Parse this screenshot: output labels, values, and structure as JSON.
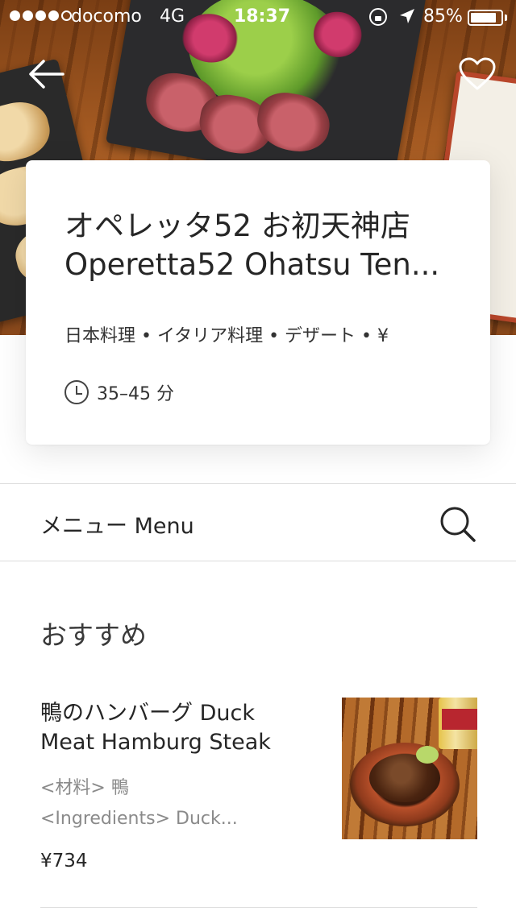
{
  "status_bar": {
    "carrier": "docomo",
    "network": "4G",
    "time": "18:37",
    "battery_percent": "85%",
    "battery_level": 0.85,
    "signal_bars_filled": 4,
    "signal_bars_total": 5
  },
  "nav": {
    "back_icon": "arrow-left-icon",
    "favorite_icon": "heart-outline-icon"
  },
  "restaurant": {
    "name_ja": "オペレッタ52 お初天神店",
    "name_en": "Operetta52 Ohatsu Ten...",
    "cuisine": "日本料理 • イタリア料理 • デザート • ¥",
    "eta": "35–45 分",
    "clock_icon": "clock-icon"
  },
  "menu_bar": {
    "label": "メニュー Menu",
    "search_icon": "search-icon"
  },
  "section": {
    "title": "おすすめ"
  },
  "items": [
    {
      "name": "鴨のハンバーグ Duck Meat Hamburg Steak",
      "desc_line1": "<材料> 鴨",
      "desc_line2": "<Ingredients> Duck...",
      "price": "¥734"
    }
  ],
  "colors": {
    "text_primary": "#262626",
    "text_secondary": "#8a8a8a",
    "divider": "#dcdcdc",
    "background": "#ffffff"
  }
}
